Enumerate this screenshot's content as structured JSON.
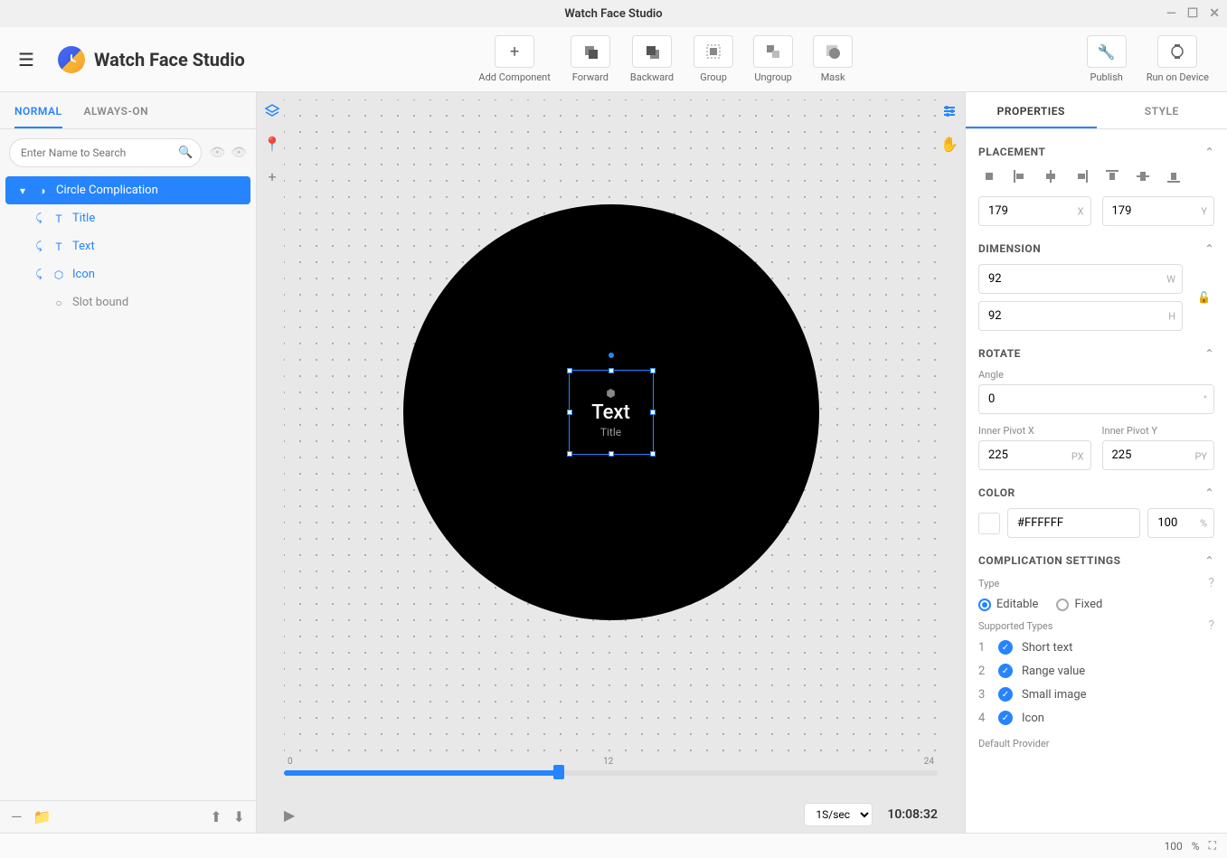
{
  "window": {
    "title": "Watch Face Studio"
  },
  "logo": {
    "text": "Watch Face Studio"
  },
  "toolbar": {
    "add": "Add Component",
    "forward": "Forward",
    "backward": "Backward",
    "group": "Group",
    "ungroup": "Ungroup",
    "mask": "Mask",
    "publish": "Publish",
    "run": "Run on Device"
  },
  "leftTabs": {
    "normal": "NORMAL",
    "always": "ALWAYS-ON"
  },
  "search": {
    "placeholder": "Enter Name to Search"
  },
  "layers": {
    "root": "Circle Complication",
    "items": [
      "Title",
      "Text",
      "Icon",
      "Slot bound"
    ]
  },
  "canvas": {
    "compText": "Text",
    "compTitle": "Title"
  },
  "timeline": {
    "start": "0",
    "mid": "12",
    "end": "24",
    "speed": "1S/sec",
    "time": "10:08:32"
  },
  "propTabs": {
    "properties": "PROPERTIES",
    "style": "STYLE"
  },
  "placement": {
    "title": "PLACEMENT",
    "x": "179",
    "y": "179"
  },
  "dimension": {
    "title": "DIMENSION",
    "w": "92",
    "h": "92"
  },
  "rotate": {
    "title": "ROTATE",
    "angleLabel": "Angle",
    "angle": "0",
    "pivotXLabel": "Inner Pivot X",
    "pivotYLabel": "Inner Pivot Y",
    "px": "225",
    "py": "225"
  },
  "color": {
    "title": "COLOR",
    "hex": "#FFFFFF",
    "opacity": "100"
  },
  "compSettings": {
    "title": "COMPLICATION SETTINGS",
    "typeLabel": "Type",
    "editable": "Editable",
    "fixed": "Fixed",
    "supportedLabel": "Supported Types",
    "types": [
      "Short text",
      "Range value",
      "Small image",
      "Icon"
    ],
    "defaultProvider": "Default Provider"
  },
  "bottomBar": {
    "zoom": "100",
    "unit": "%"
  }
}
